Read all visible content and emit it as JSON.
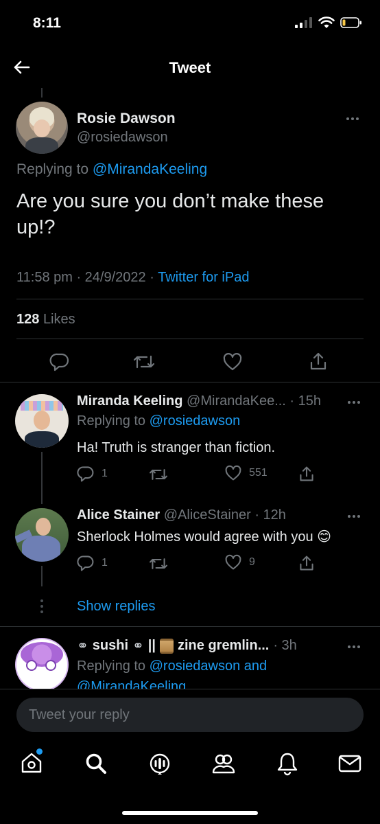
{
  "status": {
    "time": "8:11"
  },
  "header": {
    "title": "Tweet"
  },
  "main_tweet": {
    "name": "Rosie Dawson",
    "handle": "@rosiedawson",
    "replying_prefix": "Replying to ",
    "replying_to": "@MirandaKeeling",
    "text": "Are you sure you don’t make these up!?",
    "time": "11:58 pm · 24/9/2022 · ",
    "source": "Twitter for iPad",
    "likes_count": "128",
    "likes_label": "Likes"
  },
  "replies": [
    {
      "name": "Miranda Keeling",
      "meta": "@MirandaKee... · 15h",
      "replying_prefix": "Replying to ",
      "replying_to": "@rosiedawson",
      "text": "Ha! Truth is stranger than fiction.",
      "reply_count": "1",
      "like_count": "551"
    },
    {
      "name": "Alice Stainer",
      "meta": "@AliceStainer · 12h",
      "text": "Sherlock Holmes would agree with you 😊",
      "reply_count": "1",
      "like_count": "9"
    },
    {
      "name": "sushi",
      "name_rest": "zine gremlin...",
      "meta": "· 3h",
      "replying_prefix": "Replying to ",
      "replying_to": "@rosiedawson and",
      "replying_to_2": "@MirandaKeeling"
    }
  ],
  "show_replies": "Show replies",
  "compose": {
    "placeholder": "Tweet your reply"
  },
  "tabs": [
    "home-icon",
    "search-icon",
    "spaces-icon",
    "communities-icon",
    "notifications-icon",
    "messages-icon"
  ],
  "colors": {
    "accent": "#1d9bf0",
    "muted": "#71767b",
    "text": "#e7e9ea",
    "background": "#000000"
  }
}
